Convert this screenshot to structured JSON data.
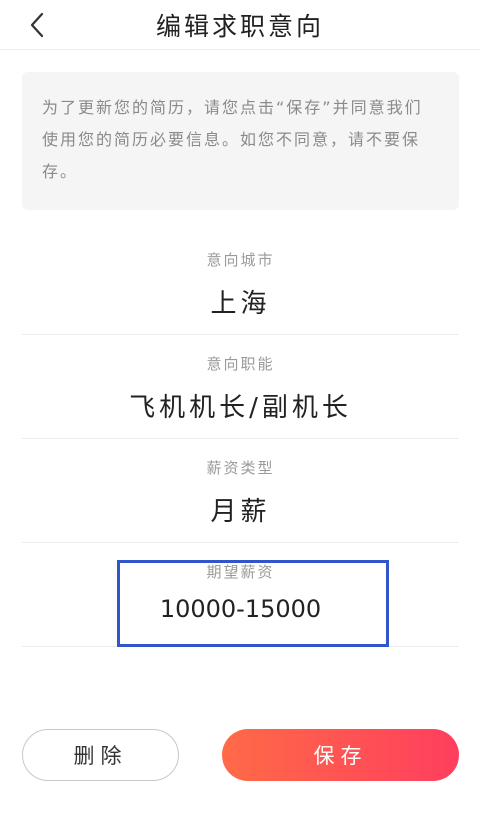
{
  "header": {
    "title": "编辑求职意向",
    "back_icon": "chevron-left-icon"
  },
  "notice": {
    "text": "为了更新您的简历，请您点击“保存”并同意我们使用您的简历必要信息。如您不同意，请不要保存。"
  },
  "fields": [
    {
      "label": "意向城市",
      "value": "上海"
    },
    {
      "label": "意向职能",
      "value": "飞机机长/副机长"
    },
    {
      "label": "薪资类型",
      "value": "月薪"
    },
    {
      "label": "期望薪资",
      "value": "10000-15000"
    }
  ],
  "buttons": {
    "delete_label": "删除",
    "save_label": "保存"
  },
  "colors": {
    "save_gradient_start": "#ff6a47",
    "save_gradient_end": "#ff3e5e",
    "highlight_box": "#3355cc"
  }
}
